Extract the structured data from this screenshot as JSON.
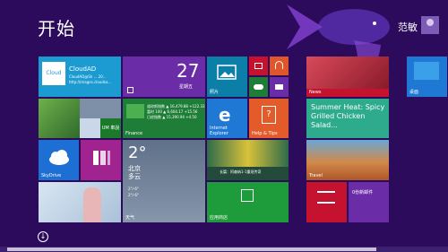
{
  "screen": {
    "title": "开始"
  },
  "user": {
    "name": "范敏"
  },
  "tiles": {
    "cloudad": {
      "title": "CloudAD",
      "line1": "CloudAD@Sh ... 20...",
      "line2": "http://images.cloudsa..."
    },
    "calendar": {
      "date": "27",
      "day": "星期五"
    },
    "photos": {
      "label": "照片"
    },
    "finance": {
      "label": "Finance",
      "rows": [
        "道琼斯指数 ▲ 16,479.88 +122.33",
        "富时 100 ▲ 6,604.17 +15.56",
        "日经指数 ▲ 15,390.94 +4.50"
      ]
    },
    "ie": {
      "label": "Internet Explorer"
    },
    "help": {
      "label": "Help & Tips"
    },
    "food": {
      "headline": "Summer Heat: Spicy Grilled Chicken Salad..."
    },
    "news": {
      "label": "News"
    },
    "desktop": {
      "label": "桌面"
    },
    "skydrive": {
      "label": "SkyDrive"
    },
    "weather": {
      "temp": "2°",
      "city": "北京",
      "condition": "多云",
      "line1": "2°/-6°",
      "line2": "2°/-6°",
      "label": "天气"
    },
    "sports": {
      "caption": "长篇：阿森纳1-1重现传奇"
    },
    "travel": {
      "label": "Travel"
    },
    "store": {
      "label": "应用商店"
    },
    "extra": {
      "label": "0份新邮件"
    },
    "music": {
      "label": "UM 車說"
    }
  }
}
